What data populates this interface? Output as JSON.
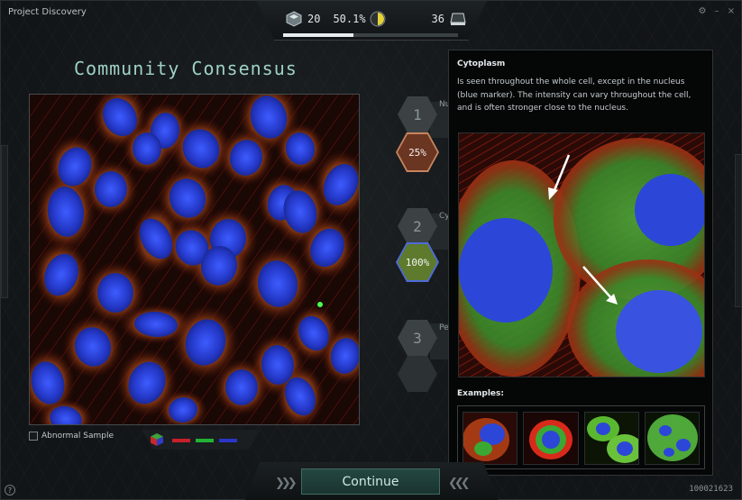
{
  "window": {
    "title": "Project Discovery",
    "controls": [
      "⚙",
      "–",
      "×"
    ]
  },
  "stats": {
    "level": "20",
    "progress_text": "50.1%",
    "progress_fraction": 0.501,
    "items": "36",
    "level_icon": "cube-icon",
    "progress_icon": "pie-meter-icon",
    "items_icon": "tray-icon",
    "xp_fraction": 0.4
  },
  "heading": "Community Consensus",
  "abnormal": {
    "label": "Abnormal Sample"
  },
  "channels": {
    "colors": [
      "#c8202a",
      "#22b234",
      "#2a36c8"
    ]
  },
  "options": [
    {
      "number": "1",
      "label": "Nu",
      "percent": "25%",
      "color": "#8c4a2f"
    },
    {
      "number": "2",
      "label": "Cy",
      "percent": "100%",
      "color": "#7a9a3a"
    },
    {
      "number": "3",
      "label": "Pe",
      "percent": "",
      "color": ""
    }
  ],
  "info": {
    "title": "Cytoplasm",
    "description": "Is seen throughout the whole cell, except in the nucleus (blue marker). The intensity can vary throughout the cell, and is often stronger close to the nucleus.",
    "examples_label": "Examples:"
  },
  "footer": {
    "continue_label": "Continue",
    "id": "100021623",
    "help": "?"
  },
  "colors": {
    "accent": "#9fd1c6",
    "nucleus": "#2a44d8",
    "actin": "#d42a1e",
    "cytoplasm": "#3aa832"
  }
}
